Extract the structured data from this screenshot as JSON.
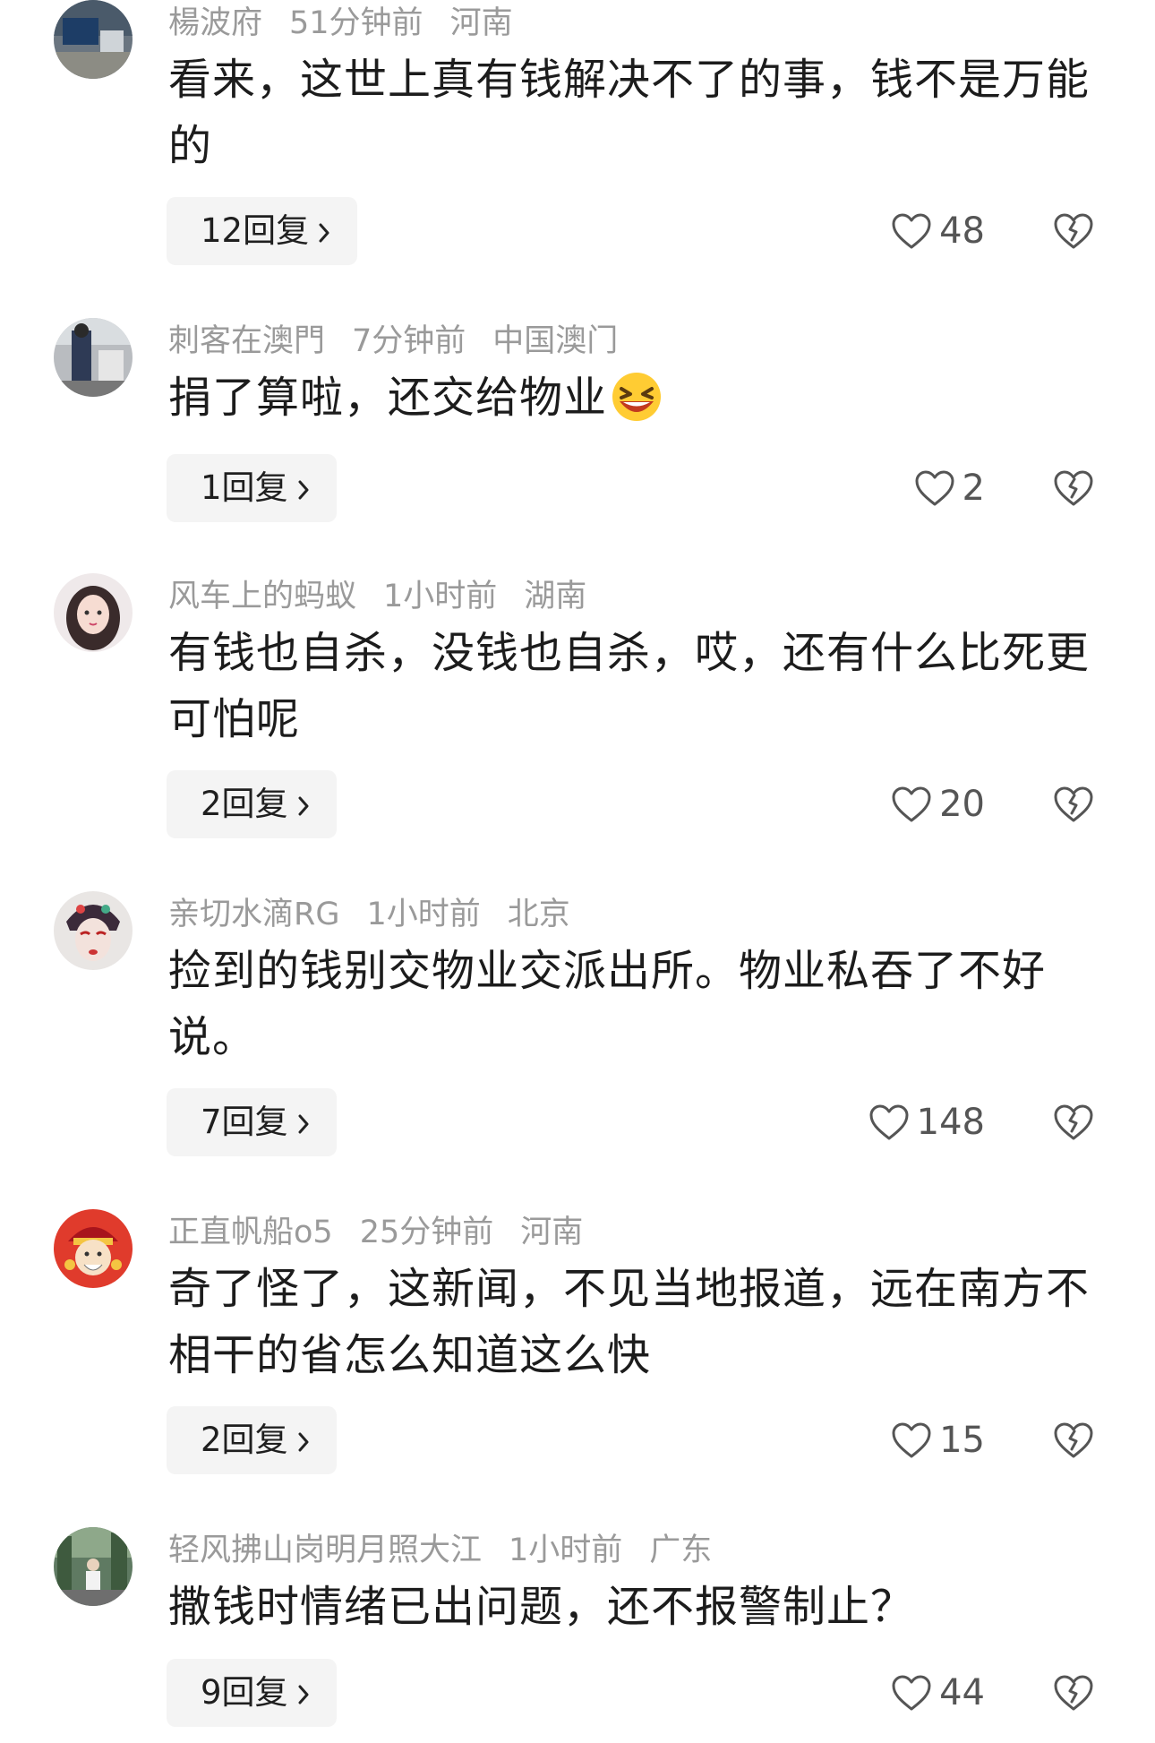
{
  "comments": [
    {
      "user": "楊波府",
      "time": "51分钟前",
      "location": "河南",
      "text": "看来，这世上真有钱解决不了的事，钱不是万能的",
      "replies": "12回复",
      "likes": "48"
    },
    {
      "user": "刺客在澳門",
      "time": "7分钟前",
      "location": "中国澳门",
      "text": "捐了算啦，还交给物业",
      "replies": "1回复",
      "likes": "2"
    },
    {
      "user": "风车上的蚂蚁",
      "time": "1小时前",
      "location": "湖南",
      "text": "有钱也自杀，没钱也自杀，哎，还有什么比死更可怕呢",
      "replies": "2回复",
      "likes": "20"
    },
    {
      "user": "亲切水滴RG",
      "time": "1小时前",
      "location": "北京",
      "text": "捡到的钱别交物业交派出所。物业私吞了不好说。",
      "replies": "7回复",
      "likes": "148"
    },
    {
      "user": "正直帆船o5",
      "time": "25分钟前",
      "location": "河南",
      "text": "奇了怪了，这新闻，不见当地报道，远在南方不相干的省怎么知道这么快",
      "replies": "2回复",
      "likes": "15"
    },
    {
      "user": "轻风拂山岗明月照大江",
      "time": "1小时前",
      "location": "广东",
      "text": "撒钱时情绪已出问题，还不报警制止？",
      "replies": "9回复",
      "likes": "44"
    }
  ],
  "icons": {
    "like": "heart-outline-icon",
    "dislike": "broken-heart-icon",
    "replies": "chevron-right-icon",
    "emoji": "laughing-emoji"
  }
}
